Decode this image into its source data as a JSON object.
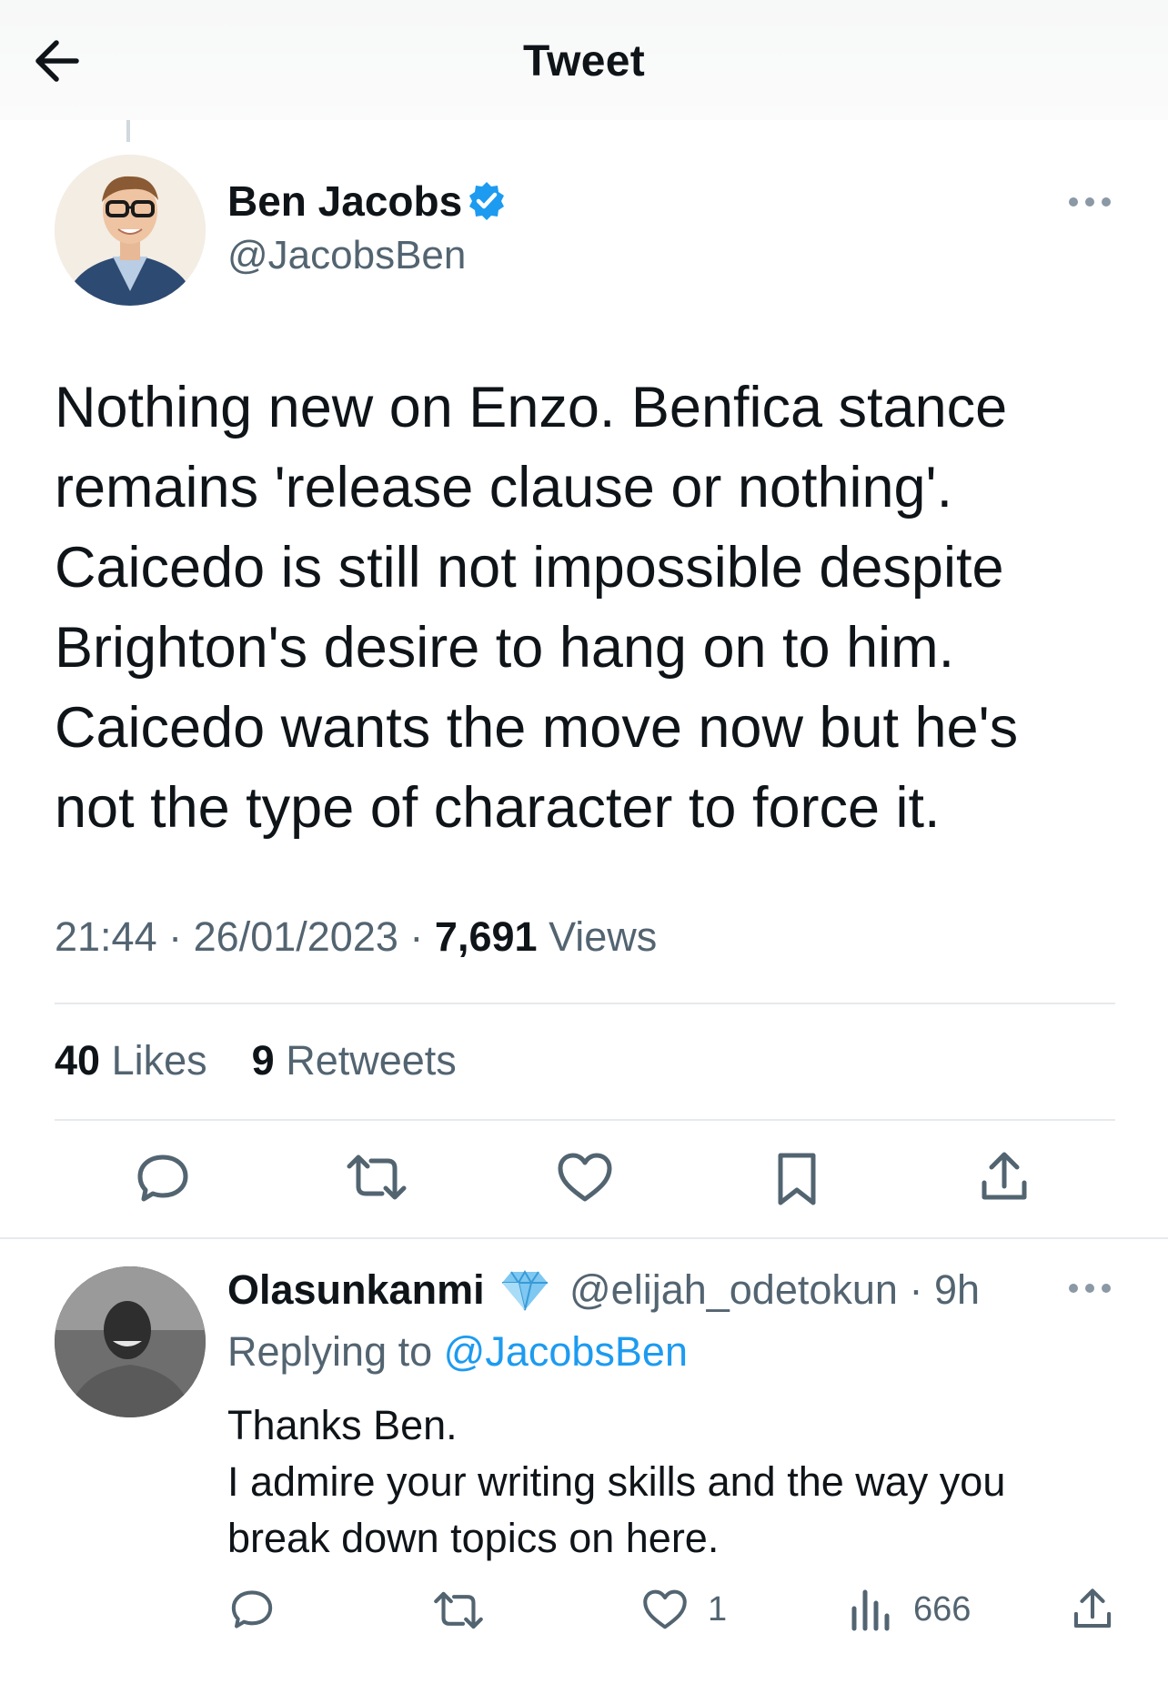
{
  "header": {
    "title": "Tweet",
    "back_icon": "arrow-left-icon"
  },
  "tweet": {
    "author_name": "Ben Jacobs",
    "author_handle": "@JacobsBen",
    "verified": true,
    "text_lines": [
      "Nothing new on Enzo. Benfica stance",
      "remains 'release clause or nothing'.",
      "Caicedo is still not impossible despite",
      "Brighton's desire to hang on to him.",
      "Caicedo wants the move now but he's",
      "not the type of character to force it."
    ],
    "time": "21:44",
    "date": "26/01/2023",
    "views_count": "7,691",
    "views_label": "Views",
    "likes_count": "40",
    "likes_label": "Likes",
    "retweets_count": "9",
    "retweets_label": "Retweets",
    "separator": "·"
  },
  "reply": {
    "author_name": "Olasunkanmi",
    "author_handle": "@elijah_odetokun",
    "time_ago": "9h",
    "replying_prefix": "Replying to",
    "replying_handle": "@JacobsBen",
    "text_lines": [
      "Thanks Ben.",
      "I admire your writing skills and the way you",
      "break down topics on here."
    ],
    "likes": "1",
    "views": "666"
  },
  "colors": {
    "accent": "#1d9bf0",
    "text": "#0f1419",
    "secondary": "#536471",
    "divider": "#e6eaed"
  }
}
